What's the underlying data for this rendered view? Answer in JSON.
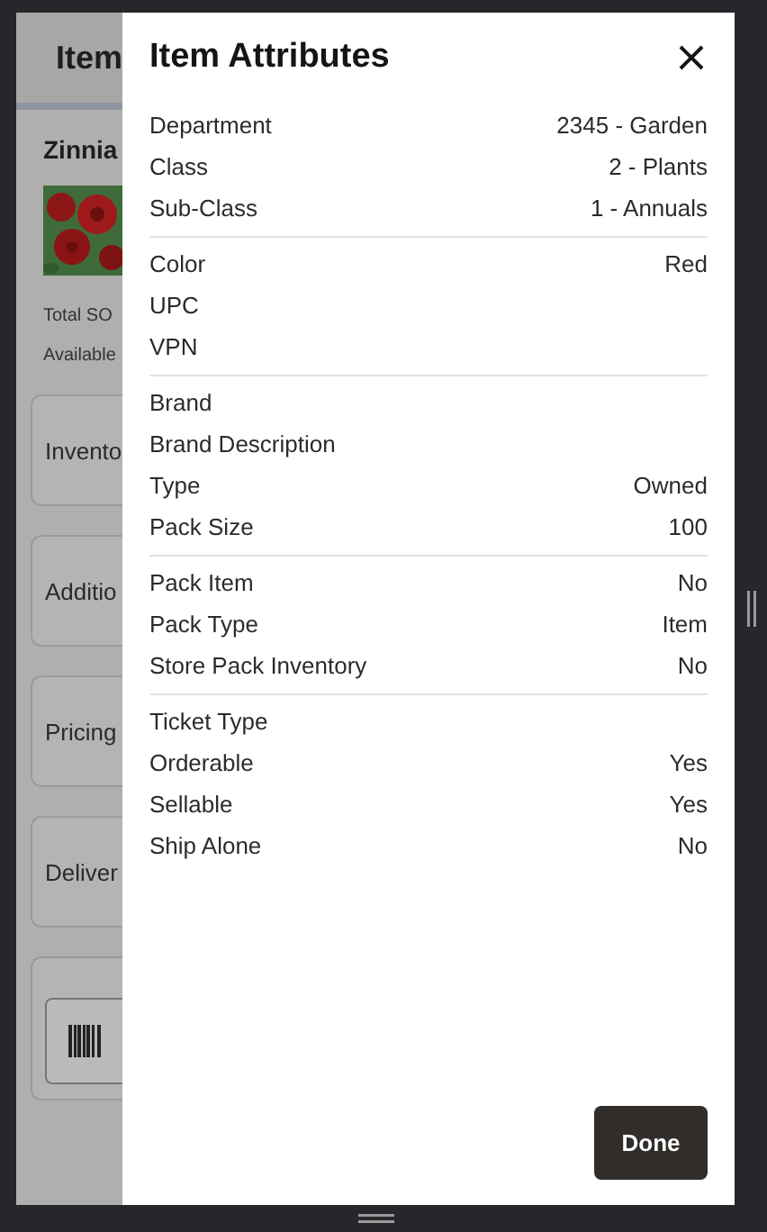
{
  "page": {
    "header_title": "Item",
    "item_name": "Zinnia",
    "image": {
      "kind": "picture"
    },
    "stats": [
      "Total SO",
      "Available"
    ],
    "cards": [
      "Invento",
      "Additio",
      "Pricing",
      "Deliver"
    ]
  },
  "dialog": {
    "title": "Item Attributes",
    "groups": [
      [
        {
          "label": "Department",
          "value": "2345 - Garden"
        },
        {
          "label": "Class",
          "value": "2 - Plants"
        },
        {
          "label": "Sub-Class",
          "value": "1 - Annuals"
        }
      ],
      [
        {
          "label": "Color",
          "value": "Red"
        },
        {
          "label": "UPC"
        },
        {
          "label": "VPN"
        }
      ],
      [
        {
          "label": "Brand"
        },
        {
          "label": "Brand Description"
        },
        {
          "label": "Type",
          "value": "Owned"
        },
        {
          "label": "Pack Size",
          "value": "100"
        }
      ],
      [
        {
          "label": "Pack Item",
          "value": "No"
        },
        {
          "label": "Pack Type",
          "value": "Item"
        },
        {
          "label": "Store Pack Inventory",
          "value": "No"
        }
      ],
      [
        {
          "label": "Ticket Type"
        },
        {
          "label": "Orderable",
          "value": "Yes"
        },
        {
          "label": "Sellable",
          "value": "Yes"
        },
        {
          "label": "Ship Alone",
          "value": "No"
        }
      ]
    ],
    "done_button": "Done"
  }
}
